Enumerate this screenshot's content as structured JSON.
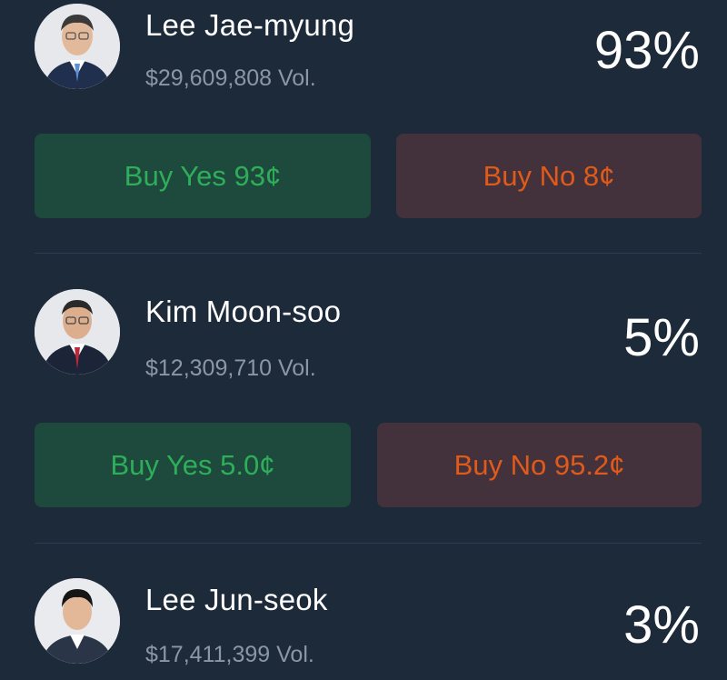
{
  "candidates": [
    {
      "name": "Lee Jae-myung",
      "volume": "$29,609,808 Vol.",
      "percent": "93%",
      "buy_yes": "Buy Yes 93¢",
      "buy_no": "Buy No 8¢"
    },
    {
      "name": "Kim Moon-soo",
      "volume": "$12,309,710 Vol.",
      "percent": "5%",
      "buy_yes": "Buy Yes 5.0¢",
      "buy_no": "Buy No 95.2¢"
    },
    {
      "name": "Lee Jun-seok",
      "volume": "$17,411,399 Vol.",
      "percent": "3%"
    }
  ],
  "colors": {
    "background": "#1d2a3a",
    "yes_bg": "#1d4a3c",
    "yes_text": "#2fae5a",
    "no_bg": "#43323c",
    "no_text": "#e05a1a"
  }
}
